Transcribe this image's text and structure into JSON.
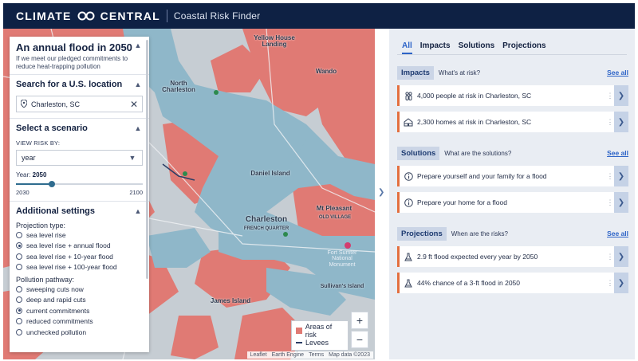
{
  "header": {
    "brand_left": "CLIMATE",
    "brand_right": "CENTRAL",
    "app_title": "Coastal Risk Finder",
    "logo_icon": "infinity-logo",
    "background": "#0e2144"
  },
  "panel": {
    "title": "An annual flood in 2050",
    "subtitle": "If we meet our pledged commitments to reduce heat-trapping pollution",
    "search": {
      "heading": "Search for a U.S. location",
      "value": "Charleston, SC"
    },
    "scenario": {
      "heading": "Select a scenario",
      "view_risk_label": "VIEW RISK BY:",
      "view_risk_value": "year",
      "year_label": "Year:",
      "year_value": "2050",
      "slider_min": "2030",
      "slider_max": "2100",
      "slider_fraction": 0.286
    },
    "settings": {
      "heading": "Additional settings",
      "projection_label": "Projection type:",
      "projection_options": [
        "sea level rise",
        "sea level rise + annual flood",
        "sea level rise + 10-year flood",
        "sea level rise + 100-year flood"
      ],
      "projection_selected": 1,
      "pollution_label": "Pollution pathway:",
      "pollution_options": [
        "sweeping cuts now",
        "deep and rapid cuts",
        "current commitments",
        "reduced commitments",
        "unchecked pollution"
      ],
      "pollution_selected": 2
    }
  },
  "map": {
    "labels": {
      "yellow_house": "Yellow House\nLanding",
      "north_charleston": "North\nCharleston",
      "daniel_island": "Daniel Island",
      "charleston": "Charleston",
      "french_quarter": "FRENCH QUARTER",
      "mount_pleasant": "Mt Pleasant",
      "old_village": "OLD VILLAGE",
      "fort_sumter": "Fort Sumter\nNational\nMonument",
      "james_island": "James Island",
      "wando": "Wando",
      "sullivans": "Sullivan's Island"
    },
    "legend": {
      "risk_label": "Areas of risk",
      "levee_label": "Levees",
      "risk_color": "#e07a74",
      "levee_color": "#2b3e66"
    },
    "attribution": [
      "Leaflet",
      "Earth Engine",
      "Terms",
      "Map data ©2023"
    ],
    "zoom_in": "+",
    "zoom_out": "−"
  },
  "right": {
    "tabs": [
      "All",
      "Impacts",
      "Solutions",
      "Projections"
    ],
    "active_tab": 0,
    "see_all": "See all",
    "sections": [
      {
        "pill": "Impacts",
        "question": "What's at risk?",
        "cards": [
          {
            "icon": "people-icon",
            "text": "4,000 people at risk in Charleston, SC"
          },
          {
            "icon": "homes-icon",
            "text": "2,300 homes at risk in Charleston, SC"
          }
        ]
      },
      {
        "pill": "Solutions",
        "question": "What are the solutions?",
        "cards": [
          {
            "icon": "info-icon",
            "text": "Prepare yourself and your family for a flood"
          },
          {
            "icon": "info-icon",
            "text": "Prepare your home for a flood"
          }
        ]
      },
      {
        "pill": "Projections",
        "question": "When are the risks?",
        "cards": [
          {
            "icon": "flask-icon",
            "text": "2.9 ft flood expected every year by 2050"
          },
          {
            "icon": "flask-icon",
            "text": "44% chance of a 3-ft flood in 2050"
          }
        ]
      }
    ],
    "card_accent": "#e36f3f",
    "link_color": "#2c63c7"
  }
}
